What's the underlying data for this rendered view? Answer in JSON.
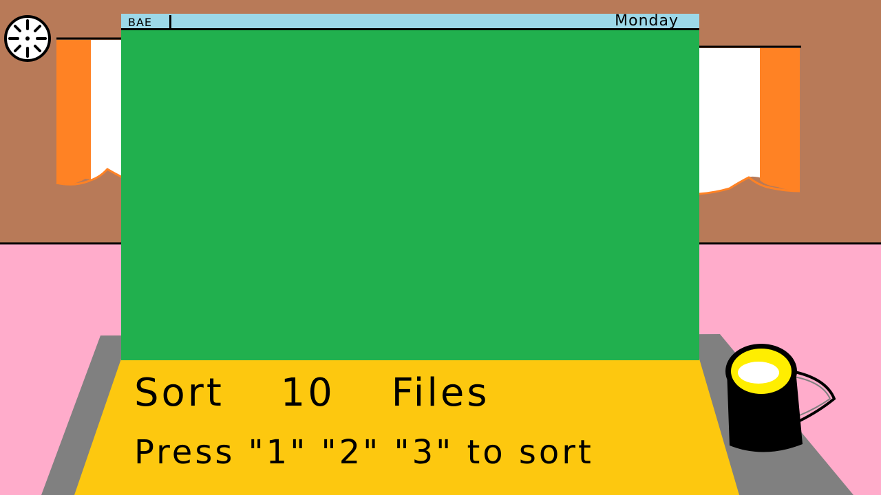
{
  "window": {
    "app_name": "BAE",
    "day": "Monday"
  },
  "task": {
    "title": "Sort 10 Files",
    "instructions": "Press \"1\" \"2\" \"3\" to sort"
  },
  "icons": {
    "wall_clock": "clock-icon",
    "mug": "coffee-mug-icon"
  },
  "colors": {
    "wall": "#b87a58",
    "floor": "#ffaccb",
    "desk": "#808080",
    "screen": "#21b04e",
    "titlebar": "#9cd8e8",
    "keyboard_panel": "#fdc80f",
    "curtain_orange": "#ff8224",
    "curtain_white": "#ffffff",
    "mug": "#000000",
    "coffee": "#ffee00"
  }
}
